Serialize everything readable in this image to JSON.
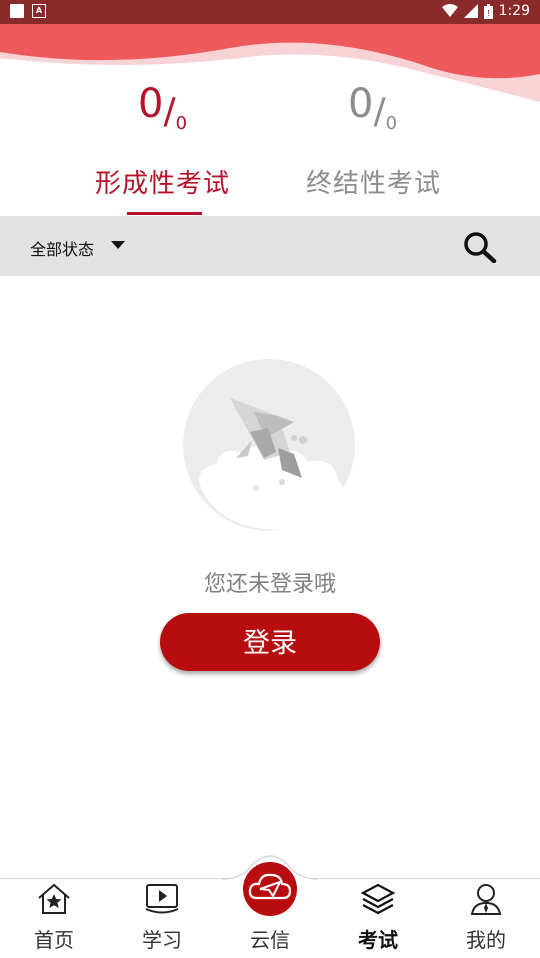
{
  "status_bar": {
    "time": "1:29"
  },
  "scores": [
    {
      "value": "0",
      "total": "0",
      "color": "#b4142a"
    },
    {
      "value": "0",
      "total": "0",
      "color": "#8c8c8c"
    }
  ],
  "tabs": [
    {
      "label": "形成性考试",
      "active": true
    },
    {
      "label": "终结性考试",
      "active": false
    }
  ],
  "filter": {
    "label": "全部状态"
  },
  "empty_state": {
    "message": "您还未登录哦",
    "login_button": "登录"
  },
  "bottom_nav": [
    {
      "label": "首页",
      "icon": "home-star-icon"
    },
    {
      "label": "学习",
      "icon": "video-book-icon"
    },
    {
      "label": "云信",
      "icon": "paper-plane-cloud-icon"
    },
    {
      "label": "考试",
      "icon": "layers-icon",
      "active": true
    },
    {
      "label": "我的",
      "icon": "user-icon"
    }
  ],
  "colors": {
    "accent": "#b80d0f",
    "status_bar": "#8a2b2b",
    "wave": "#ee5a5a"
  }
}
